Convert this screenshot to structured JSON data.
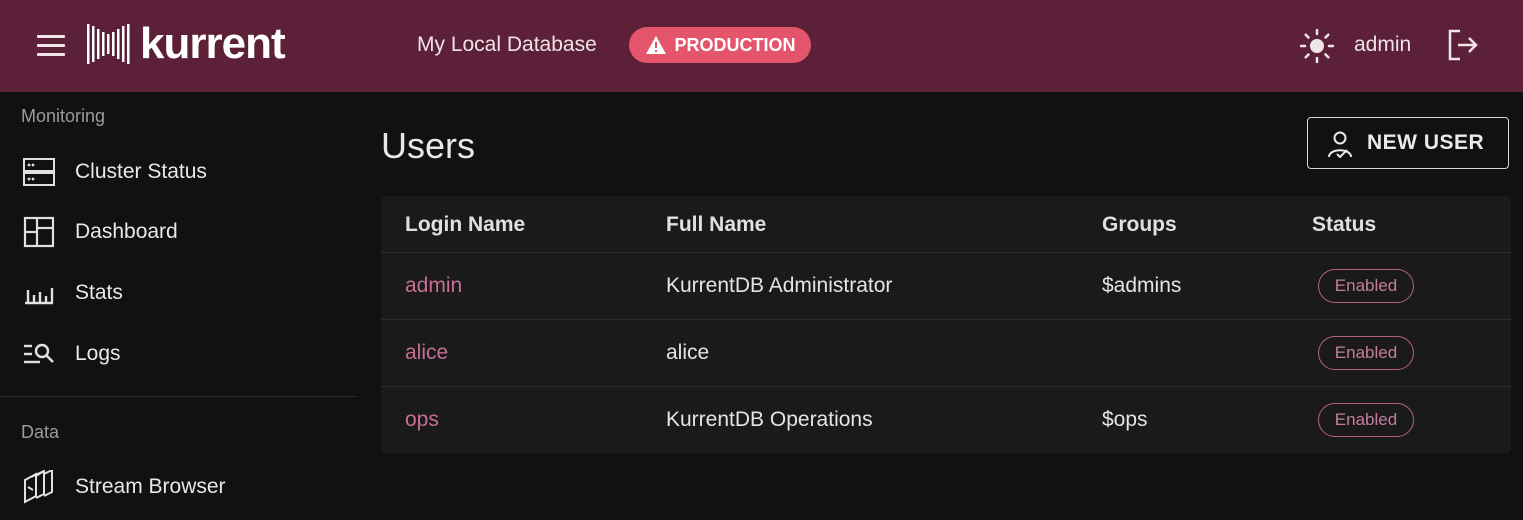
{
  "header": {
    "logo_text": "kurrent",
    "database_name": "My Local Database",
    "environment_badge": "PRODUCTION",
    "username": "admin",
    "icons": [
      "menu-icon",
      "warning-icon",
      "theme-sun-icon",
      "logout-icon"
    ],
    "colors": {
      "bar": "#5c2138",
      "badge": "#e4546a"
    }
  },
  "sidebar": {
    "sections": [
      {
        "label": "Monitoring",
        "items": [
          {
            "label": "Cluster Status",
            "icon": "server-icon"
          },
          {
            "label": "Dashboard",
            "icon": "dashboard-icon"
          },
          {
            "label": "Stats",
            "icon": "stats-icon"
          },
          {
            "label": "Logs",
            "icon": "logs-search-icon"
          }
        ]
      },
      {
        "label": "Data",
        "items": [
          {
            "label": "Stream Browser",
            "icon": "stream-browser-icon"
          }
        ]
      }
    ]
  },
  "main": {
    "title": "Users",
    "new_user_button": "NEW USER",
    "table": {
      "columns": [
        "Login Name",
        "Full Name",
        "Groups",
        "Status"
      ],
      "rows": [
        {
          "login": "admin",
          "full_name": "KurrentDB Administrator",
          "groups": "$admins",
          "status": "Enabled"
        },
        {
          "login": "alice",
          "full_name": "alice",
          "groups": "",
          "status": "Enabled"
        },
        {
          "login": "ops",
          "full_name": "KurrentDB Operations",
          "groups": "$ops",
          "status": "Enabled"
        }
      ]
    },
    "colors": {
      "login_link": "#c66f95",
      "status_badge": "#b66282"
    }
  }
}
